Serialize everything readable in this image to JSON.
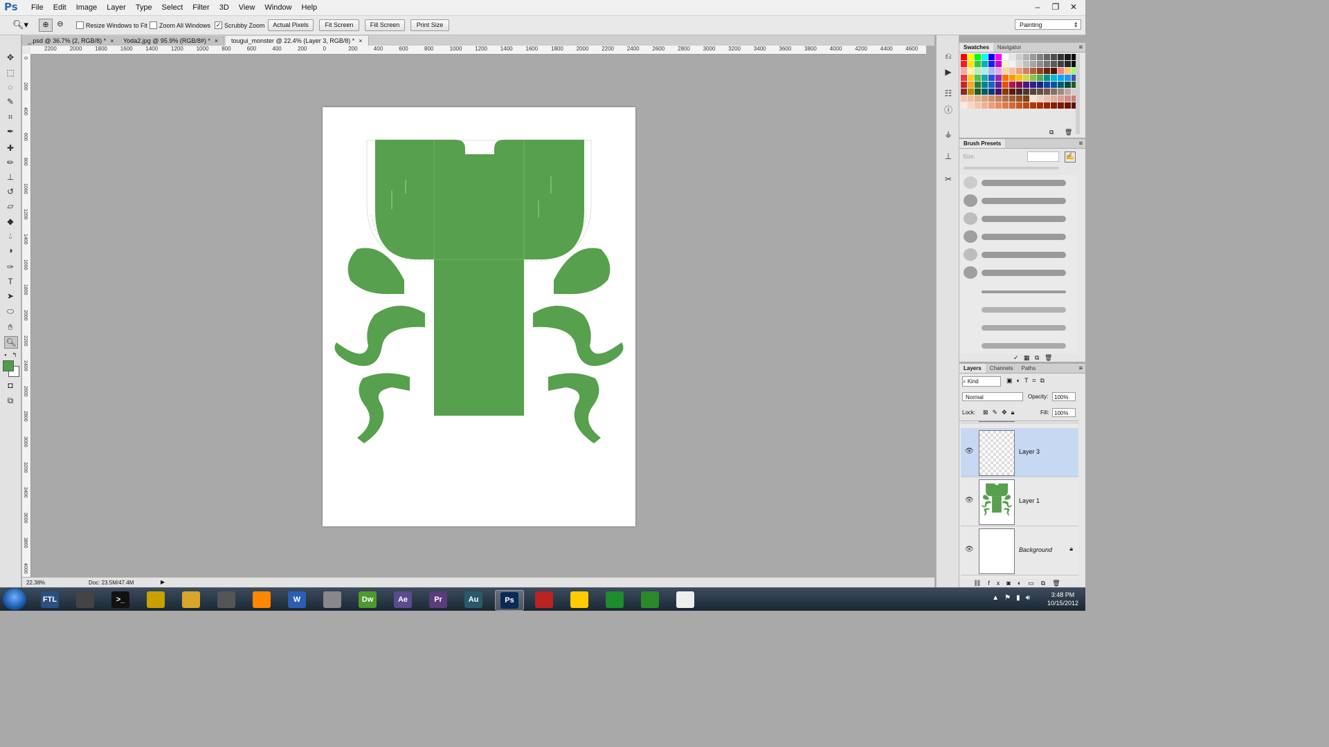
{
  "app": {
    "logo": "Ps"
  },
  "menu": [
    "File",
    "Edit",
    "Image",
    "Layer",
    "Type",
    "Select",
    "Filter",
    "3D",
    "View",
    "Window",
    "Help"
  ],
  "window_controls": {
    "minimize": "–",
    "restore": "❐",
    "close": "✕"
  },
  "options": {
    "resize_windows": {
      "label": "Resize Windows to Fit",
      "checked": false
    },
    "zoom_all": {
      "label": "Zoom All Windows",
      "checked": false
    },
    "scrubby_zoom": {
      "label": "Scrubby Zoom",
      "checked": true,
      "mark": "✓"
    },
    "actual_pixels": "Actual Pixels",
    "fit_screen": "Fit Screen",
    "fill_screen": "Fill Screen",
    "print_size": "Print Size",
    "workspace": "Painting"
  },
  "doc_tabs": [
    {
      "label": "_.psd @ 36.7% (2, RGB/8) *",
      "close": "×"
    },
    {
      "label": "Yoda2.jpg @ 95.9% (RGB/8#) *",
      "close": "×"
    },
    {
      "label": "tougui_monster @ 22.4% (Layer 3, RGB/8) *",
      "close": "×"
    }
  ],
  "ruler_top": [
    "2200",
    "2000",
    "1800",
    "1600",
    "1400",
    "1200",
    "1000",
    "800",
    "600",
    "400",
    "200",
    "0",
    "200",
    "400",
    "600",
    "800",
    "1000",
    "1200",
    "1400",
    "1600",
    "1800",
    "2000",
    "2200",
    "2400",
    "2600",
    "2800",
    "3000",
    "3200",
    "3400",
    "3600",
    "3800",
    "4000",
    "4200",
    "4400",
    "4600"
  ],
  "ruler_left": [
    "0",
    "200",
    "400",
    "600",
    "800",
    "1000",
    "1200",
    "1400",
    "1600",
    "1800",
    "2000",
    "2200",
    "2400",
    "2600",
    "2800",
    "3000",
    "3200",
    "3400",
    "3600",
    "3800",
    "4000"
  ],
  "status": {
    "zoom": "22.38%",
    "doc": "Doc: 23.5M/47.4M",
    "arrow": "▶"
  },
  "colors": {
    "foreground": "#4e9f47",
    "background": "#ffffff",
    "artwork": "#57a04d"
  },
  "swatches_panel": {
    "tabs": [
      "Swatches",
      "Navigator"
    ],
    "menu": "≡"
  },
  "swatches": [
    "#ff0000",
    "#ffff00",
    "#00ff00",
    "#00ffff",
    "#0000ff",
    "#ff00ff",
    "#ffffff",
    "#e6e6e6",
    "#cccccc",
    "#b3b3b3",
    "#999999",
    "#808080",
    "#666666",
    "#4d4d4d",
    "#333333",
    "#1a1a1a",
    "#000000",
    "#ff1a1a",
    "#ffe600",
    "#33cc33",
    "#00b3b3",
    "#1a1aff",
    "#cc00cc",
    "#ffeecc",
    "#f2f2f2",
    "#d9d9d9",
    "#bfbfbf",
    "#a6a6a6",
    "#8c8c8c",
    "#737373",
    "#595959",
    "#404040",
    "#262626",
    "#0d0d0d",
    "#f7a8a8",
    "#fff3a8",
    "#b8f0b0",
    "#a8eef0",
    "#a8b8f5",
    "#e8a8f0",
    "#f5d7a8",
    "#f0c0a0",
    "#e8a080",
    "#d08060",
    "#b06040",
    "#904020",
    "#702000",
    "#501000",
    "#ff8080",
    "#ffcc66",
    "#99ff66",
    "#e83a3a",
    "#f7d11c",
    "#4cc34c",
    "#19a6a6",
    "#2b4fd6",
    "#9d27b0",
    "#ff6f00",
    "#ff9800",
    "#ffc107",
    "#cddc39",
    "#8bc34a",
    "#4caf50",
    "#009688",
    "#00bcd4",
    "#03a9f4",
    "#2196f3",
    "#3f51b5",
    "#c62828",
    "#f9a825",
    "#2e7d32",
    "#00838f",
    "#1565c0",
    "#6a1b9a",
    "#e65100",
    "#ad1457",
    "#880e4f",
    "#4a148c",
    "#311b92",
    "#1a237e",
    "#0d47a1",
    "#01579b",
    "#006064",
    "#004d40",
    "#1b5e20",
    "#8d2b2b",
    "#b58b00",
    "#1e5e1e",
    "#005f66",
    "#0d3b7a",
    "#4a0f6e",
    "#8a3b00",
    "#5d1a0f",
    "#3e2723",
    "#4e342e",
    "#5d4037",
    "#6d4c41",
    "#795548",
    "#8d6e63",
    "#a1887f",
    "#bcaaa4",
    "#d7ccc8",
    "#f4c7b0",
    "#eebf9f",
    "#e8b08a",
    "#dda078",
    "#d09068",
    "#c08058",
    "#b07048",
    "#a06038",
    "#905028",
    "#804018",
    "#f8e0d0",
    "#f0d0c0",
    "#e8c0b0",
    "#e0b0a0",
    "#d8a090",
    "#d09080",
    "#c88070",
    "#fde9df",
    "#fad7c4",
    "#f6c4aa",
    "#f1b190",
    "#ec9e76",
    "#e68c5e",
    "#df7a48",
    "#d66833",
    "#cc5720",
    "#c04710",
    "#b43805",
    "#a82c00",
    "#9a2400",
    "#8c1e00",
    "#7e1800",
    "#701200",
    "#620c00"
  ],
  "brush_panel": {
    "title": "Brush Presets",
    "size_label": "Size:",
    "menu": "≡"
  },
  "layers_panel": {
    "tabs": [
      "Layers",
      "Channels",
      "Paths"
    ],
    "filter": "Kind",
    "blend_mode": "Normal",
    "opacity_label": "Opacity:",
    "opacity": "100%",
    "lock_label": "Lock:",
    "fill_label": "Fill:",
    "fill": "100%",
    "menu": "≡",
    "layers": [
      {
        "name": "Layer 3",
        "selected": true
      },
      {
        "name": "Layer 1",
        "selected": false
      },
      {
        "name": "Background",
        "selected": false,
        "locked": true
      }
    ]
  },
  "taskbar": {
    "apps": [
      "FTL",
      "",
      ">_",
      "",
      "",
      "",
      "",
      "W",
      "",
      "Dw",
      "Ae",
      "Pr",
      "Au",
      "Ps",
      "",
      "",
      "",
      "",
      ""
    ],
    "time": "3:48 PM",
    "date": "10/15/2012"
  }
}
